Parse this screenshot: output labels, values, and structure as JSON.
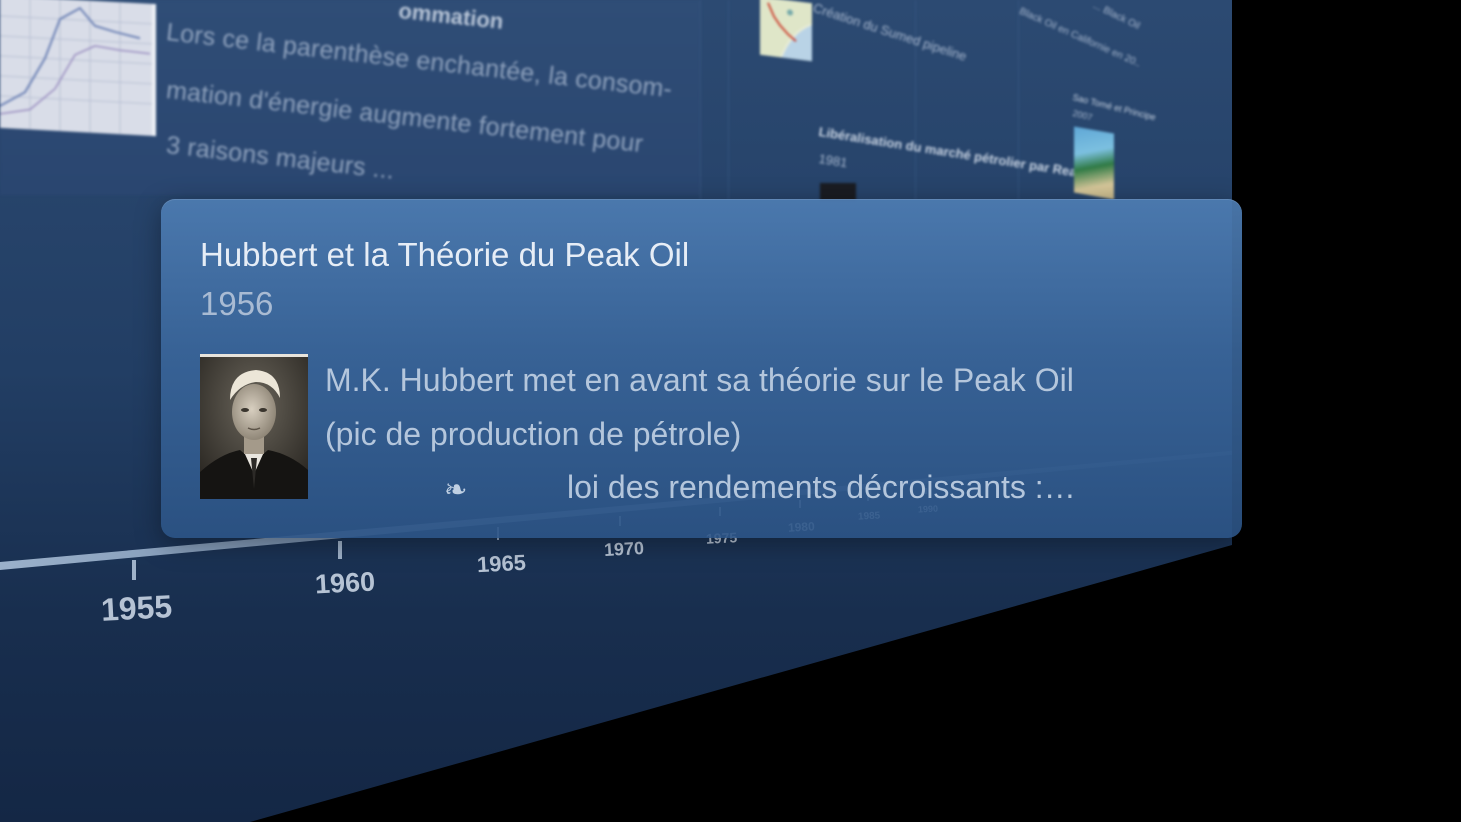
{
  "background": {
    "card_title": "ommation",
    "card_lines": [
      "Lors ce la parenthèse enchantée, la consom-",
      "mation d'énergie augmente fortement pour",
      "3 raisons majeurs ..."
    ],
    "sumed_caption": "Création du Sumed pipeline",
    "reagan_title": "Libéralisation du marché pétrolier par Reagan",
    "reagan_year": "1981",
    "black_oil_caption": "Black Oil en Californie en 20..",
    "top_right_caption": "... Black Oil",
    "sao_tome_title": "Sao Tomé et Principe",
    "sao_tome_year": "2007"
  },
  "timeline": {
    "ticks": [
      {
        "label": "1955"
      },
      {
        "label": "1960"
      },
      {
        "label": "1965"
      },
      {
        "label": "1970"
      },
      {
        "label": "1975"
      },
      {
        "label": "1980"
      },
      {
        "label": "1985"
      },
      {
        "label": "1990"
      }
    ]
  },
  "popup": {
    "title": "Hubbert et la Théorie du Peak Oil",
    "year": "1956",
    "photo_alt": "portrait-photo",
    "body_line_1": "M.K. Hubbert met en avant sa théorie sur le Peak Oil",
    "body_line_2": "(pic de production de pétrole)",
    "fleuron": "❧",
    "body_line_3": "loi des rendements décroissants :…"
  },
  "colors": {
    "wall": "#223e64",
    "popup": "#3a669b",
    "title_text": "#e6edf6",
    "body_text": "#b4c6dc"
  }
}
